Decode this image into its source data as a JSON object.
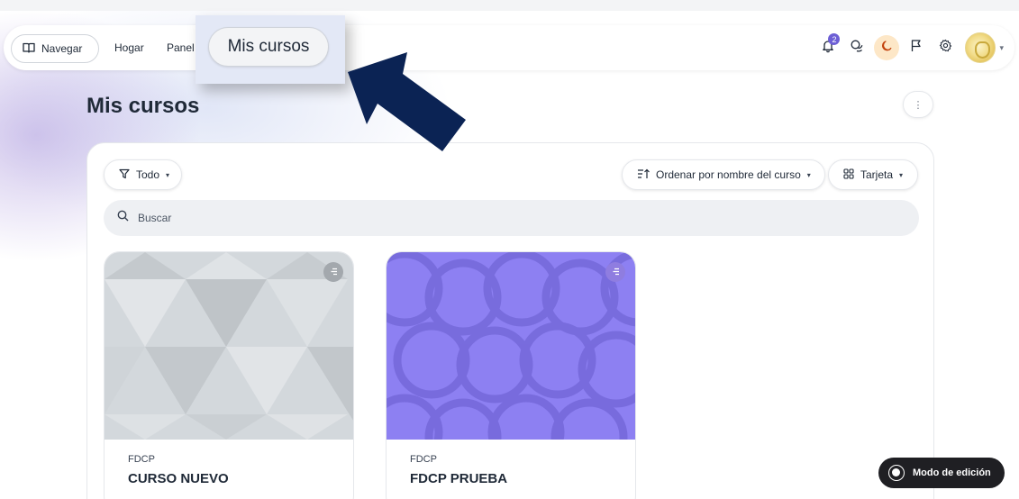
{
  "navbar": {
    "navigate_label": "Navegar",
    "home_label": "Hogar",
    "panel_label": "Panel",
    "notification_count": "2"
  },
  "callout": {
    "label": "Mis cursos"
  },
  "page": {
    "title": "Mis cursos"
  },
  "filters": {
    "grouping_label": "Todo",
    "sort_label": "Ordenar por nombre del curso",
    "view_label": "Tarjeta"
  },
  "search": {
    "placeholder": "Buscar"
  },
  "courses": [
    {
      "category": "FDCP",
      "name": "CURSO NUEVO"
    },
    {
      "category": "FDCP",
      "name": "FDCP PRUEBA"
    }
  ],
  "edit_mode": {
    "label": "Modo de edición"
  },
  "colors": {
    "accent": "#6d5fd5",
    "arrow": "#0b2354",
    "card1_bg": "#d5d9dd",
    "card2_bg": "#8b7fef",
    "edit_bg": "#1f1f23"
  },
  "icons": {
    "navigate": "book-open-icon",
    "notifications": "bell-icon",
    "messages": "chat-icon",
    "theme": "moon-icon",
    "flag": "flag-icon",
    "settings": "gear-icon",
    "filter": "filter-icon",
    "sort": "sort-icon",
    "view": "grid-icon",
    "search": "search-icon"
  }
}
